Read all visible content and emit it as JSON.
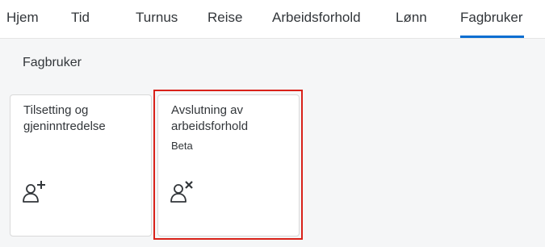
{
  "nav": {
    "tabs": [
      {
        "label": "Hjem"
      },
      {
        "label": "Tid"
      },
      {
        "label": "Turnus"
      },
      {
        "label": "Reise"
      },
      {
        "label": "Arbeidsforhold"
      },
      {
        "label": "Lønn"
      },
      {
        "label": "Fagbruker",
        "active": true
      }
    ]
  },
  "section": {
    "title": "Fagbruker"
  },
  "tiles": [
    {
      "title": "Tilsetting og\ngjeninntredelse",
      "subtitle": "",
      "icon": "add-person-icon"
    },
    {
      "title": "Avslutning av\narbeidsforhold",
      "subtitle": "Beta",
      "icon": "remove-person-icon"
    }
  ],
  "colors": {
    "accent": "#0a6ed1",
    "text": "#32363a",
    "highlight": "#d9221a",
    "background": "#f5f6f7"
  }
}
